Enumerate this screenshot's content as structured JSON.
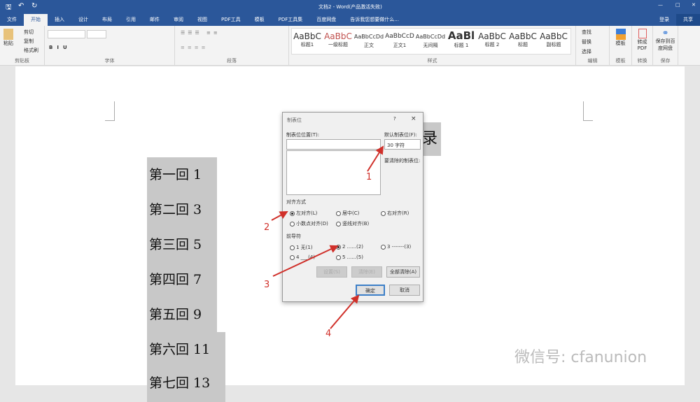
{
  "title": "文档2 - Word(产品激活失败)",
  "quick_access": {
    "save": "save-icon",
    "undo": "undo-icon",
    "redo": "redo-icon"
  },
  "account": {
    "login": "登录",
    "share": "共享"
  },
  "tabs": [
    "文件",
    "开始",
    "插入",
    "设计",
    "布局",
    "引用",
    "邮件",
    "审阅",
    "视图",
    "PDF工具",
    "模板",
    "PDF工具集",
    "百度网盘"
  ],
  "tell_me": "告诉我您想要做什么...",
  "ribbon": {
    "clipboard": {
      "paste": "粘贴",
      "cut": "剪切",
      "copy": "复制",
      "format_painter": "格式刷",
      "label": "剪贴板"
    },
    "font": {
      "label": "字体"
    },
    "paragraph": {
      "label": "段落"
    },
    "styles": {
      "label": "样式",
      "items": [
        {
          "preview": "AaBbC",
          "name": "标题1"
        },
        {
          "preview": "AaBbC",
          "name": "一级标题"
        },
        {
          "preview": "AaBbCcDd",
          "name": "正文"
        },
        {
          "preview": "AaBbCcD",
          "name": "正文1"
        },
        {
          "preview": "AaBbCcDd",
          "name": "无间隔"
        },
        {
          "preview": "AaBl",
          "name": "标题 1"
        },
        {
          "preview": "AaBbC",
          "name": "标题 2"
        },
        {
          "preview": "AaBbC",
          "name": "标题"
        },
        {
          "preview": "AaBbC",
          "name": "副标题"
        }
      ]
    },
    "editing": {
      "find": "查找",
      "replace": "替换",
      "select": "选择",
      "label": "编辑"
    },
    "template": {
      "btn": "模板",
      "label": "模板"
    },
    "convert": {
      "btn": "转成PDF",
      "label": "转换"
    },
    "save": {
      "btn": "保存到百度网盘",
      "label": "保存"
    }
  },
  "document": {
    "heading_fragment": "录",
    "lines": [
      "第一回 1",
      "第二回 3",
      "第三回 5",
      "第四回 7",
      "第五回 9",
      "第六回 11",
      "第七回 13"
    ]
  },
  "dialog": {
    "title": "制表位",
    "help": "?",
    "close": "×",
    "tab_position_label": "制表位位置(T):",
    "tab_position_value": "",
    "default_tab_label": "默认制表位(F):",
    "default_tab_value": "30 字符",
    "clear_label": "要清除的制表位:",
    "alignment_label": "对齐方式",
    "alignment": [
      {
        "label": "左对齐(L)",
        "on": true
      },
      {
        "label": "居中(C)",
        "on": false
      },
      {
        "label": "右对齐(R)",
        "on": false
      },
      {
        "label": "小数点对齐(D)",
        "on": false
      },
      {
        "label": "竖线对齐(B)",
        "on": false
      }
    ],
    "leader_label": "前导符",
    "leader": [
      {
        "label": "1 无(1)",
        "on": false
      },
      {
        "label": "2 ......(2)",
        "on": true
      },
      {
        "label": "3 -------(3)",
        "on": false
      },
      {
        "label": "4 ___(4)",
        "on": false
      },
      {
        "label": "5 ......(5)",
        "on": false
      }
    ],
    "set": "设置(S)",
    "clear": "清除(E)",
    "clear_all": "全部清除(A)",
    "ok": "确定",
    "cancel": "取消"
  },
  "annotations": [
    "1",
    "2",
    "3",
    "4"
  ],
  "watermark": "微信号: cfanunion",
  "colors": {
    "accent": "#2b579a",
    "arrow": "#d0302a"
  }
}
